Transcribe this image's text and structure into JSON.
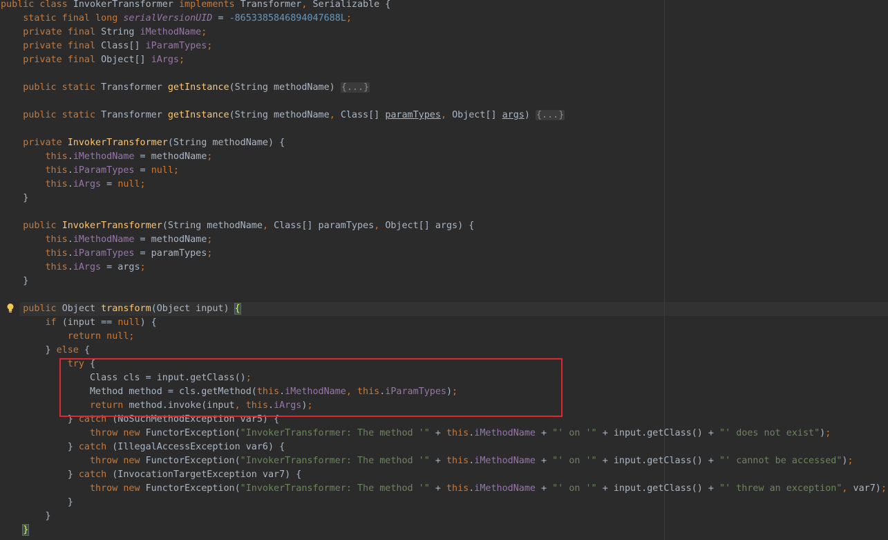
{
  "editor": {
    "lines": [
      [
        {
          "t": "public class ",
          "c": "k"
        },
        {
          "t": "InvokerTransformer "
        },
        {
          "t": "implements ",
          "c": "k"
        },
        {
          "t": "Transformer"
        },
        {
          "t": ", ",
          "c": "k"
        },
        {
          "t": "Serializable {"
        }
      ],
      [
        {
          "t": "    static final long ",
          "c": "k"
        },
        {
          "t": "serialVersionUID",
          "c": "fi"
        },
        {
          "t": " = "
        },
        {
          "t": "-8653385846894047688L",
          "c": "n"
        },
        {
          "t": ";",
          "c": "k"
        }
      ],
      [
        {
          "t": "    private final ",
          "c": "k"
        },
        {
          "t": "String "
        },
        {
          "t": "iMethodName",
          "c": "f"
        },
        {
          "t": ";",
          "c": "k"
        }
      ],
      [
        {
          "t": "    private final ",
          "c": "k"
        },
        {
          "t": "Class[] "
        },
        {
          "t": "iParamTypes",
          "c": "f"
        },
        {
          "t": ";",
          "c": "k"
        }
      ],
      [
        {
          "t": "    private final ",
          "c": "k"
        },
        {
          "t": "Object[] "
        },
        {
          "t": "iArgs",
          "c": "f"
        },
        {
          "t": ";",
          "c": "k"
        }
      ],
      [],
      [
        {
          "t": "    public static ",
          "c": "k"
        },
        {
          "t": "Transformer "
        },
        {
          "t": "getInstance",
          "c": "m"
        },
        {
          "t": "(String methodName) "
        },
        {
          "t": "{...}",
          "c": "fold"
        }
      ],
      [],
      [
        {
          "t": "    public static ",
          "c": "k"
        },
        {
          "t": "Transformer "
        },
        {
          "t": "getInstance",
          "c": "m"
        },
        {
          "t": "(String methodName"
        },
        {
          "t": ", ",
          "c": "k"
        },
        {
          "t": "Class[] "
        },
        {
          "t": "paramTypes",
          "c": "u"
        },
        {
          "t": ", ",
          "c": "k"
        },
        {
          "t": "Object[] "
        },
        {
          "t": "args",
          "c": "u"
        },
        {
          "t": ") "
        },
        {
          "t": "{...}",
          "c": "fold"
        }
      ],
      [],
      [
        {
          "t": "    private ",
          "c": "k"
        },
        {
          "t": "InvokerTransformer",
          "c": "m"
        },
        {
          "t": "(String methodName) {"
        }
      ],
      [
        {
          "t": "        this",
          "c": "k"
        },
        {
          "t": "."
        },
        {
          "t": "iMethodName",
          "c": "f"
        },
        {
          "t": " = methodName"
        },
        {
          "t": ";",
          "c": "k"
        }
      ],
      [
        {
          "t": "        this",
          "c": "k"
        },
        {
          "t": "."
        },
        {
          "t": "iParamTypes",
          "c": "f"
        },
        {
          "t": " = "
        },
        {
          "t": "null;",
          "c": "k"
        }
      ],
      [
        {
          "t": "        this",
          "c": "k"
        },
        {
          "t": "."
        },
        {
          "t": "iArgs",
          "c": "f"
        },
        {
          "t": " = "
        },
        {
          "t": "null;",
          "c": "k"
        }
      ],
      [
        {
          "t": "    }"
        }
      ],
      [],
      [
        {
          "t": "    public ",
          "c": "k"
        },
        {
          "t": "InvokerTransformer",
          "c": "m"
        },
        {
          "t": "(String methodName"
        },
        {
          "t": ", ",
          "c": "k"
        },
        {
          "t": "Class[] paramTypes"
        },
        {
          "t": ", ",
          "c": "k"
        },
        {
          "t": "Object[] args) {"
        }
      ],
      [
        {
          "t": "        this",
          "c": "k"
        },
        {
          "t": "."
        },
        {
          "t": "iMethodName",
          "c": "f"
        },
        {
          "t": " = methodName"
        },
        {
          "t": ";",
          "c": "k"
        }
      ],
      [
        {
          "t": "        this",
          "c": "k"
        },
        {
          "t": "."
        },
        {
          "t": "iParamTypes",
          "c": "f"
        },
        {
          "t": " = paramTypes"
        },
        {
          "t": ";",
          "c": "k"
        }
      ],
      [
        {
          "t": "        this",
          "c": "k"
        },
        {
          "t": "."
        },
        {
          "t": "iArgs",
          "c": "f"
        },
        {
          "t": " = args"
        },
        {
          "t": ";",
          "c": "k"
        }
      ],
      [
        {
          "t": "    }"
        }
      ],
      [],
      [
        {
          "t": "    public ",
          "c": "k"
        },
        {
          "t": "Object "
        },
        {
          "t": "transform",
          "c": "m"
        },
        {
          "t": "(Object input) "
        },
        {
          "t": "{",
          "c": "brace-hl"
        }
      ],
      [
        {
          "t": "        if ",
          "c": "k"
        },
        {
          "t": "(input == "
        },
        {
          "t": "null",
          "c": "k"
        },
        {
          "t": ") {"
        }
      ],
      [
        {
          "t": "            return null;",
          "c": "k"
        }
      ],
      [
        {
          "t": "        } "
        },
        {
          "t": "else ",
          "c": "k"
        },
        {
          "t": "{"
        }
      ],
      [
        {
          "t": "            try ",
          "c": "k"
        },
        {
          "t": "{"
        }
      ],
      [
        {
          "t": "                Class cls = input.getClass()"
        },
        {
          "t": ";",
          "c": "k"
        }
      ],
      [
        {
          "t": "                Method method = cls.getMethod("
        },
        {
          "t": "this",
          "c": "k"
        },
        {
          "t": "."
        },
        {
          "t": "iMethodName",
          "c": "f"
        },
        {
          "t": ", ",
          "c": "k"
        },
        {
          "t": "this",
          "c": "k"
        },
        {
          "t": "."
        },
        {
          "t": "iParamTypes",
          "c": "f"
        },
        {
          "t": ")"
        },
        {
          "t": ";",
          "c": "k"
        }
      ],
      [
        {
          "t": "                return ",
          "c": "k"
        },
        {
          "t": "method.invoke(input"
        },
        {
          "t": ", ",
          "c": "k"
        },
        {
          "t": "this",
          "c": "k"
        },
        {
          "t": "."
        },
        {
          "t": "iArgs",
          "c": "f"
        },
        {
          "t": ")"
        },
        {
          "t": ";",
          "c": "k"
        }
      ],
      [
        {
          "t": "            } "
        },
        {
          "t": "catch ",
          "c": "k"
        },
        {
          "t": "(NoSuchMethodException var5) {"
        }
      ],
      [
        {
          "t": "                throw new ",
          "c": "k"
        },
        {
          "t": "FunctorException("
        },
        {
          "t": "\"InvokerTransformer: The method '\"",
          "c": "s"
        },
        {
          "t": " + "
        },
        {
          "t": "this",
          "c": "k"
        },
        {
          "t": "."
        },
        {
          "t": "iMethodName",
          "c": "f"
        },
        {
          "t": " + "
        },
        {
          "t": "\"' on '\"",
          "c": "s"
        },
        {
          "t": " + input.getClass() + "
        },
        {
          "t": "\"' does not exist\"",
          "c": "s"
        },
        {
          "t": ")"
        },
        {
          "t": ";",
          "c": "k"
        }
      ],
      [
        {
          "t": "            } "
        },
        {
          "t": "catch ",
          "c": "k"
        },
        {
          "t": "(IllegalAccessException var6) {"
        }
      ],
      [
        {
          "t": "                throw new ",
          "c": "k"
        },
        {
          "t": "FunctorException("
        },
        {
          "t": "\"InvokerTransformer: The method '\"",
          "c": "s"
        },
        {
          "t": " + "
        },
        {
          "t": "this",
          "c": "k"
        },
        {
          "t": "."
        },
        {
          "t": "iMethodName",
          "c": "f"
        },
        {
          "t": " + "
        },
        {
          "t": "\"' on '\"",
          "c": "s"
        },
        {
          "t": " + input.getClass() + "
        },
        {
          "t": "\"' cannot be accessed\"",
          "c": "s"
        },
        {
          "t": ")"
        },
        {
          "t": ";",
          "c": "k"
        }
      ],
      [
        {
          "t": "            } "
        },
        {
          "t": "catch ",
          "c": "k"
        },
        {
          "t": "(InvocationTargetException var7) {"
        }
      ],
      [
        {
          "t": "                throw new ",
          "c": "k"
        },
        {
          "t": "FunctorException("
        },
        {
          "t": "\"InvokerTransformer: The method '\"",
          "c": "s"
        },
        {
          "t": " + "
        },
        {
          "t": "this",
          "c": "k"
        },
        {
          "t": "."
        },
        {
          "t": "iMethodName",
          "c": "f"
        },
        {
          "t": " + "
        },
        {
          "t": "\"' on '\"",
          "c": "s"
        },
        {
          "t": " + input.getClass() + "
        },
        {
          "t": "\"' threw an exception\"",
          "c": "s"
        },
        {
          "t": ", ",
          "c": "k"
        },
        {
          "t": "var7)"
        },
        {
          "t": ";",
          "c": "k"
        }
      ],
      [
        {
          "t": "            }"
        }
      ],
      [
        {
          "t": "        }"
        }
      ],
      [
        {
          "t": "    "
        },
        {
          "t": "}",
          "c": "brace-hl"
        }
      ]
    ],
    "colors": {
      "background": "#2b2b2b",
      "keyword": "#cc7832",
      "field": "#9876aa",
      "number": "#6897bb",
      "string": "#6a8759",
      "method": "#ffc66d",
      "highlight_box": "#e0262e"
    },
    "icons": {
      "gutter_hint": "lightbulb-icon"
    }
  }
}
